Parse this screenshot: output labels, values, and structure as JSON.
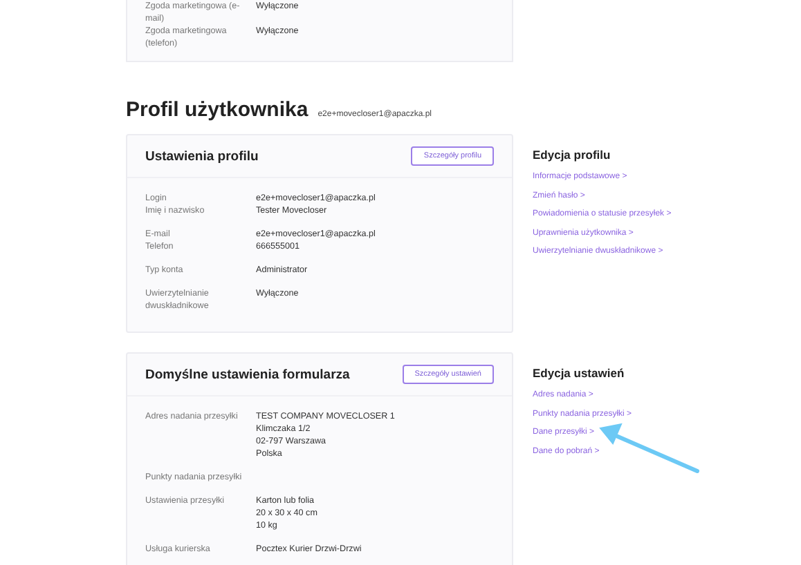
{
  "consent_card": {
    "rows": [
      {
        "label": "Zgoda marketingowa (e-mail)",
        "values": [
          "Wyłączone"
        ]
      },
      {
        "label": "Zgoda marketingowa (telefon)",
        "values": [
          "Wyłączone"
        ]
      }
    ]
  },
  "profile": {
    "title": "Profil użytkownika",
    "email": "e2e+movecloser1@apaczka.pl"
  },
  "sections": [
    {
      "card": {
        "title": "Ustawienia profilu",
        "button": "Szczegóły profilu",
        "groups": [
          [
            {
              "label": "Login",
              "values": [
                "e2e+movecloser1@apaczka.pl"
              ]
            },
            {
              "label": "Imię i nazwisko",
              "values": [
                "Tester Movecloser"
              ]
            }
          ],
          [
            {
              "label": "E-mail",
              "values": [
                "e2e+movecloser1@apaczka.pl"
              ]
            },
            {
              "label": "Telefon",
              "values": [
                "666555001"
              ]
            }
          ],
          [
            {
              "label": "Typ konta",
              "values": [
                "Administrator"
              ]
            }
          ],
          [
            {
              "label": "Uwierzytelnianie dwuskładnikowe",
              "values": [
                "Wyłączone"
              ]
            }
          ]
        ]
      },
      "panel": {
        "title": "Edycja profilu",
        "links": [
          "Informacje podstawowe >",
          "Zmień hasło >",
          "Powiadomienia o statusie przesyłek >",
          "Uprawnienia użytkownika >",
          "Uwierzytelnianie dwuskładnikowe >"
        ]
      }
    },
    {
      "card": {
        "title": "Domyślne ustawienia formularza",
        "button": "Szczegóły ustawień",
        "groups": [
          [
            {
              "label": "Adres nadania przesyłki",
              "values": [
                "TEST COMPANY MOVECLOSER 1",
                "Klimczaka 1/2",
                "02-797 Warszawa",
                "Polska"
              ]
            }
          ],
          [
            {
              "label": "Punkty nadania przesyłki"
            }
          ],
          [
            {
              "label": "Ustawienia przesyłki",
              "values": [
                "Karton lub folia",
                "20 x 30 x 40 cm",
                "10 kg"
              ]
            }
          ],
          [
            {
              "label": "Usługa kurierska",
              "values": [
                "Pocztex Kurier Drzwi-Drzwi"
              ]
            }
          ]
        ]
      },
      "panel": {
        "title": "Edycja ustawień",
        "links": [
          "Adres nadania >",
          "Punkty nadania przesyłki >",
          "Dane przesyłki >",
          "Dane do pobrań >"
        ]
      }
    }
  ]
}
